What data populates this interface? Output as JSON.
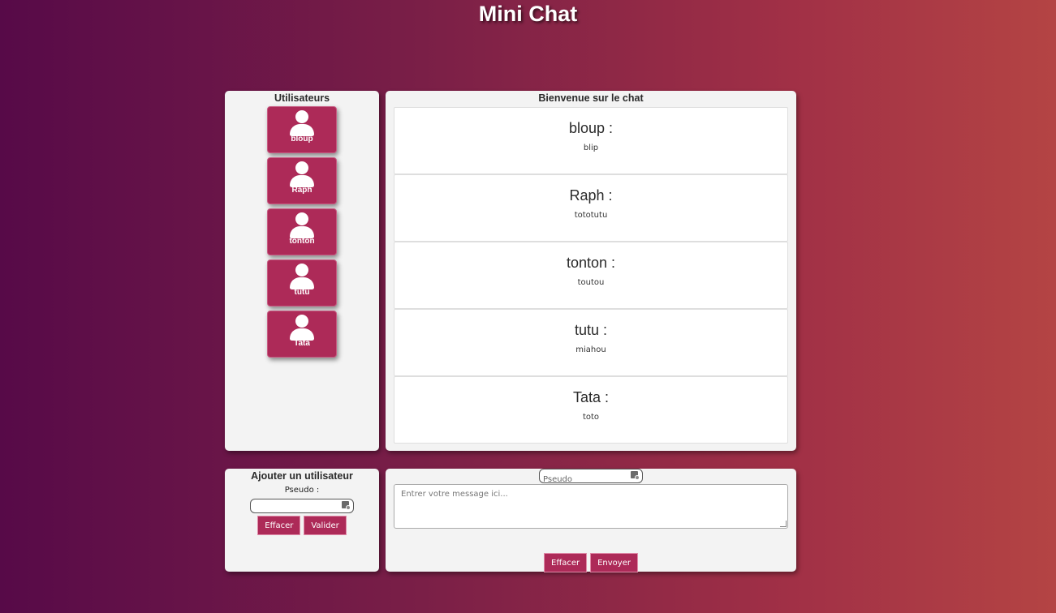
{
  "header": {
    "title": "Mini Chat"
  },
  "users_panel": {
    "title": "Utilisateurs",
    "users": [
      "bloup",
      "Raph",
      "tonton",
      "tutu",
      "Tata"
    ]
  },
  "chat_panel": {
    "title": "Bienvenue sur le chat",
    "messages": [
      {
        "author": "bloup :",
        "text": "blip"
      },
      {
        "author": "Raph :",
        "text": "tototutu"
      },
      {
        "author": "tonton :",
        "text": "toutou"
      },
      {
        "author": "tutu :",
        "text": "miahou"
      },
      {
        "author": "Tata :",
        "text": "toto"
      }
    ]
  },
  "add_user": {
    "title": "Ajouter un utilisateur",
    "pseudo_label": "Pseudo :",
    "pseudo_value": "",
    "clear_label": "Effacer",
    "submit_label": "Valider"
  },
  "compose": {
    "pseudo_placeholder": "Pseudo",
    "message_placeholder": "Entrer votre message ici...",
    "clear_label": "Effacer",
    "send_label": "Envoyer"
  },
  "colors": {
    "accent": "#ad2a58",
    "panel_bg": "#f3f3f3",
    "gradient_start": "#570a48",
    "gradient_end": "#b44444"
  }
}
